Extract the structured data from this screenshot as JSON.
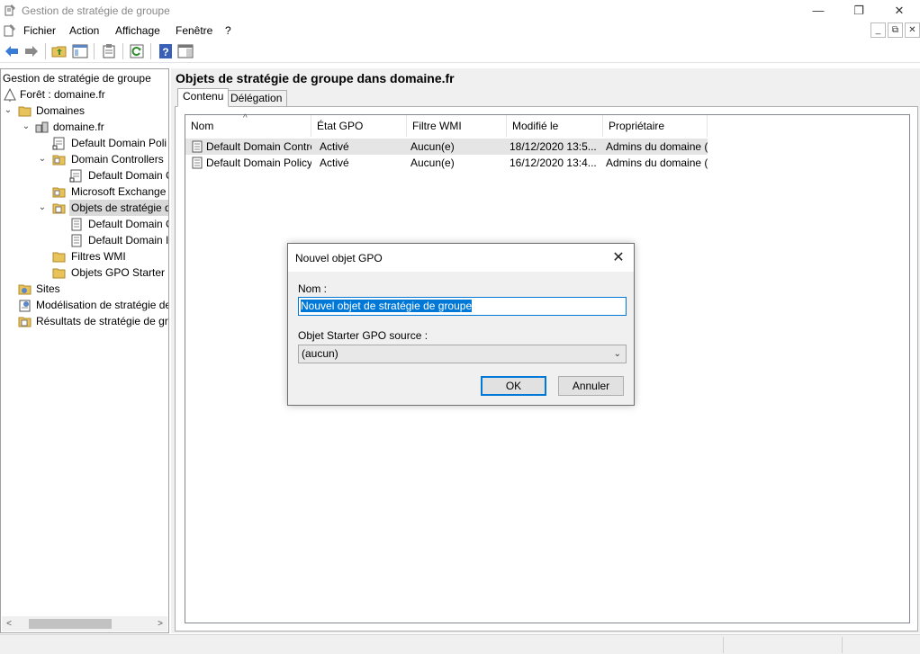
{
  "window": {
    "title": "Gestion de stratégie de groupe",
    "minimize": "—",
    "restore": "❐",
    "close": "✕"
  },
  "menu": {
    "items": [
      "Fichier",
      "Action",
      "Affichage",
      "Fenêtre",
      "?"
    ],
    "mdi_min": "_",
    "mdi_restore": "⧉",
    "mdi_close": "✕"
  },
  "tree": {
    "root": "Gestion de stratégie de groupe",
    "items": [
      {
        "label": "Forêt : domaine.fr",
        "icon": "forest-icon",
        "chev": ""
      },
      {
        "label": "Domaines",
        "icon": "folder-icon",
        "chev": "⌄"
      },
      {
        "label": "domaine.fr",
        "icon": "domain-icon",
        "chev": "⌄"
      },
      {
        "label": "Default Domain Poli",
        "icon": "gpo-link-icon",
        "chev": ""
      },
      {
        "label": "Domain Controllers",
        "icon": "ou-folder-icon",
        "chev": "⌄"
      },
      {
        "label": "Default Domain C",
        "icon": "gpo-link-icon",
        "chev": ""
      },
      {
        "label": "Microsoft Exchange",
        "icon": "ou-folder-icon",
        "chev": ""
      },
      {
        "label": "Objets de stratégie d",
        "icon": "gpo-folder-icon",
        "chev": "⌄"
      },
      {
        "label": "Default Domain C",
        "icon": "gpo-icon",
        "chev": ""
      },
      {
        "label": "Default Domain I",
        "icon": "gpo-icon",
        "chev": ""
      },
      {
        "label": "Filtres WMI",
        "icon": "folder-icon",
        "chev": ""
      },
      {
        "label": "Objets GPO Starter",
        "icon": "folder-icon",
        "chev": ""
      },
      {
        "label": "Sites",
        "icon": "sites-icon",
        "chev": ""
      },
      {
        "label": "Modélisation de stratégie de",
        "icon": "modeling-icon",
        "chev": ""
      },
      {
        "label": "Résultats de stratégie de gro",
        "icon": "results-icon",
        "chev": ""
      }
    ]
  },
  "right": {
    "title": "Objets de stratégie de groupe dans domaine.fr",
    "tabs": [
      "Contenu",
      "Délégation"
    ],
    "columns": [
      "Nom",
      "État GPO",
      "Filtre WMI",
      "Modifié le",
      "Propriétaire"
    ],
    "rows": [
      [
        "Default Domain Control...",
        "Activé",
        "Aucun(e)",
        "18/12/2020 13:5...",
        "Admins du domaine (..."
      ],
      [
        "Default Domain Policy",
        "Activé",
        "Aucun(e)",
        "16/12/2020 13:4...",
        "Admins du domaine (..."
      ]
    ]
  },
  "dialog": {
    "title": "Nouvel objet GPO",
    "name_label": "Nom :",
    "name_value": "Nouvel objet de stratégie de groupe",
    "starter_label": "Objet Starter GPO source :",
    "starter_value": "(aucun)",
    "ok": "OK",
    "cancel": "Annuler",
    "close": "✕"
  },
  "colors": {
    "accent": "#0078d7",
    "folder": "#e8c25a",
    "selection": "#d9d9d9"
  }
}
